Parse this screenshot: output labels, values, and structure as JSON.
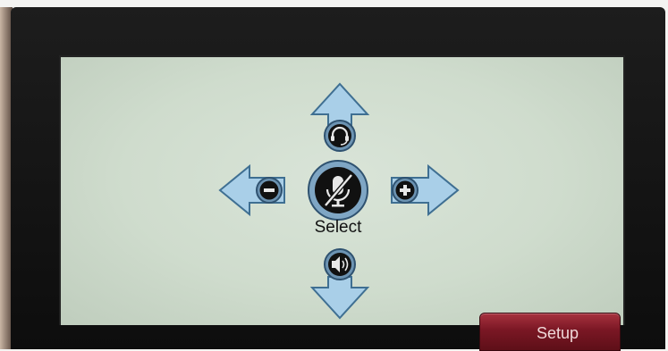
{
  "controls": {
    "center_label": "Select",
    "setup_label": "Setup"
  },
  "icons": {
    "up": "headset-icon",
    "left": "minus-icon",
    "center": "mic-muted-icon",
    "right": "plus-icon",
    "down": "speaker-icon"
  },
  "colors": {
    "arrow_fill": "#a9cfe8",
    "arrow_stroke": "#3f6f92",
    "screen_bg": "#d3dfd1",
    "setup_button": "#7a1724"
  }
}
